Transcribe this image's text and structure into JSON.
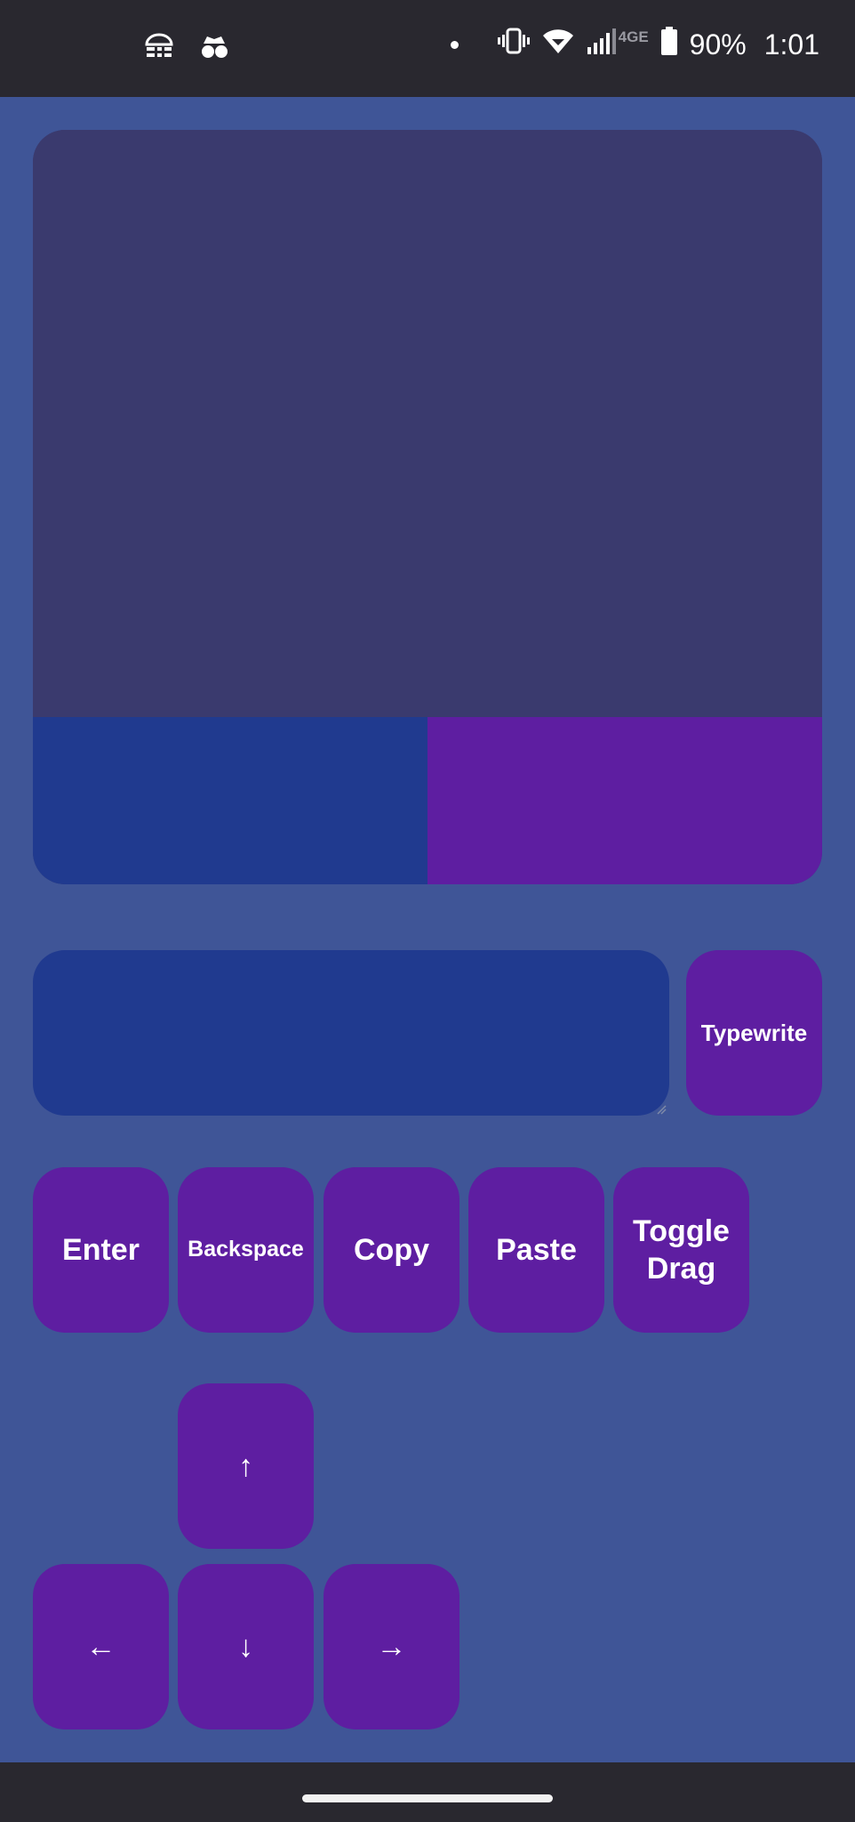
{
  "status_bar": {
    "left_icons": [
      "data-saver-icon",
      "incognito-icon"
    ],
    "right_icons": [
      "notification-dot-icon",
      "vibrate-icon",
      "wifi-icon",
      "signal-icon",
      "battery-icon"
    ],
    "network_label": "4GE",
    "battery_percent": "90%",
    "time": "1:01"
  },
  "touchpad": {
    "surface_color": "#3a3a6e",
    "left_click_color": "#203a8f",
    "right_click_color": "#5e1ea1"
  },
  "text_input": {
    "value": "",
    "placeholder": ""
  },
  "buttons": {
    "typewrite": "Typewrite",
    "enter": "Enter",
    "backspace": "Backspace",
    "copy": "Copy",
    "paste": "Paste",
    "toggle_drag": "Toggle\nDrag"
  },
  "arrows": {
    "up": "↑",
    "left": "←",
    "down": "↓",
    "right": "→"
  },
  "colors": {
    "background": "#3f5597",
    "button": "#5e1ea1",
    "system_bars": "#29282f"
  }
}
